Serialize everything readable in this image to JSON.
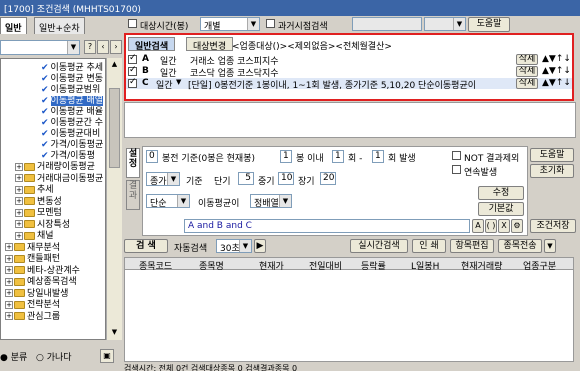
{
  "window": {
    "title": "[1700] 조건검색 (MHHTS01700)"
  },
  "left_panel": {
    "tabs": [
      "일반",
      "일반+순차"
    ],
    "tree": {
      "checked_items": [
        "이동평균 추세",
        "이동평균 변동",
        "이동평균범위",
        "이동평균 배열",
        "이동평균 배율",
        "이동평균간 수",
        "이동평균대비",
        "가격/이동평균",
        "가격/이동평"
      ],
      "groups": [
        {
          "label": "거래량이동평균",
          "expanded": false,
          "indent": 1
        },
        {
          "label": "거래대금이동평균",
          "expanded": false,
          "indent": 1
        },
        {
          "label": "추세",
          "expanded": false,
          "indent": 1
        },
        {
          "label": "변동성",
          "expanded": false,
          "indent": 1
        },
        {
          "label": "모멘텀",
          "expanded": false,
          "indent": 1
        },
        {
          "label": "시장특성",
          "expanded": false,
          "indent": 1
        },
        {
          "label": "채널",
          "expanded": false,
          "indent": 1
        },
        {
          "label": "재무분석",
          "expanded": false,
          "indent": 0
        },
        {
          "label": "캔들패턴",
          "expanded": false,
          "indent": 0
        },
        {
          "label": "베타-상관계수",
          "expanded": false,
          "indent": 0
        },
        {
          "label": "예상종목검색",
          "expanded": false,
          "indent": 0
        },
        {
          "label": "당일내발생",
          "expanded": false,
          "indent": 0
        },
        {
          "label": "전략분석",
          "expanded": false,
          "indent": 0
        },
        {
          "label": "관심그룹",
          "expanded": false,
          "indent": 0
        }
      ]
    },
    "bottom_radio": [
      "분류",
      "가나다"
    ]
  },
  "top_bar": {
    "target_time_label": "대상시간(봉)",
    "target_time_value": "개별",
    "past_search_label": "과거시점검색",
    "help_button": "도움말"
  },
  "condition_box": {
    "tab_general": "일반검색",
    "tab_target_change": "대상변경",
    "target_text": "<업종대상()><제외없음><전체월결산>",
    "rows": [
      {
        "letter": "A",
        "period": "일간",
        "desc": "거래소 업종 코스피지수",
        "delete": "삭제"
      },
      {
        "letter": "B",
        "period": "일간",
        "desc": "코스닥 업종 코스닥지수",
        "delete": "삭제"
      },
      {
        "letter": "C",
        "period": "일간",
        "desc": "[단일] 0봉전기준 1봉이내, 1~1회 발생, 종가기준 5,10,20 단순이동평균이",
        "delete": "삭제"
      }
    ]
  },
  "settings": {
    "vtabs": [
      "설정",
      "결과"
    ],
    "bars_before": "0",
    "line1_text1": "봉전 기준(0봉은 현재봉)",
    "within_bars": "1",
    "line1_text2": "봉 이내",
    "times_from": "1",
    "dash": "회 -",
    "times_to": "1",
    "line1_text3": "회 발생",
    "not_result": "NOT 결과제외",
    "consecutive": "연속발생",
    "price_basis": "종가",
    "basis_label": "기준",
    "short_label": "단기",
    "short_value": "5",
    "mid_label": "중기",
    "mid_value": "10",
    "long_label": "장기",
    "long_value": "20",
    "ma_type": "단순",
    "ma_label": "이동평균이",
    "arrangement": "정배열",
    "btn_help": "도움말",
    "btn_reset": "초기화",
    "btn_modify": "수정",
    "btn_default": "기본값",
    "btn_save": "조건저장",
    "formula": "A and B and C"
  },
  "search": {
    "label": "검 색",
    "auto_label": "자동검색",
    "interval": "30초",
    "realtime": "실시간검색",
    "print": "인 쇄",
    "edit_items": "항목편집",
    "send_items": "종목전송"
  },
  "grid": {
    "columns": [
      "종목코드",
      "종목명",
      "현재가",
      "전일대비",
      "등락률",
      "L일봉H",
      "현재거래량",
      "업종구분"
    ]
  },
  "status": {
    "text": "검색시간:   전체 0건   검색대상종목   0   검색결과종목   0"
  }
}
